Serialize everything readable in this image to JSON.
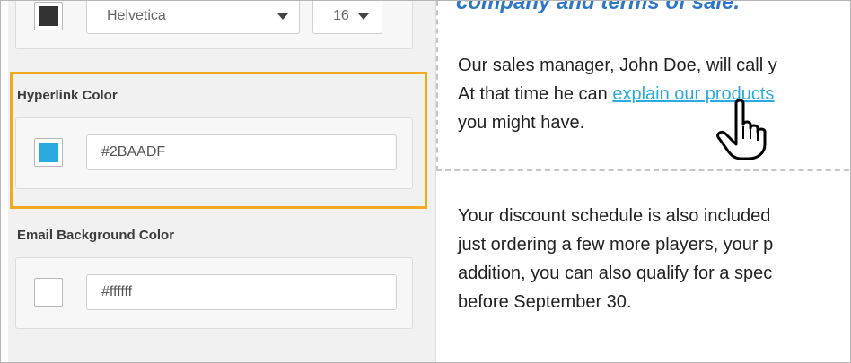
{
  "font_controls": {
    "text_color": "#333333",
    "font_family": "Helvetica",
    "font_size": "16"
  },
  "hyperlink": {
    "label": "Hyperlink Color",
    "value": "#2BAADF",
    "swatch_color": "#2BAADF"
  },
  "email_background": {
    "label": "Email Background Color",
    "value": "#ffffff",
    "swatch_color": "#ffffff"
  },
  "highlight_color": "#f4a81d",
  "preview": {
    "heading_fragment": "company and terms of sale.",
    "paragraph1": {
      "line1": "Our sales manager, John Doe, will call y",
      "line2_prefix": "At that time he can ",
      "link_text": "explain our products",
      "line3": "you might have."
    },
    "paragraph2": {
      "line1": " Your discount schedule is also included",
      "line2": "just ordering a few more players, your p",
      "line3": "addition, you can also qualify for a spec",
      "line4": "before September 30."
    }
  },
  "cursor_icon": "hand-pointer-icon"
}
